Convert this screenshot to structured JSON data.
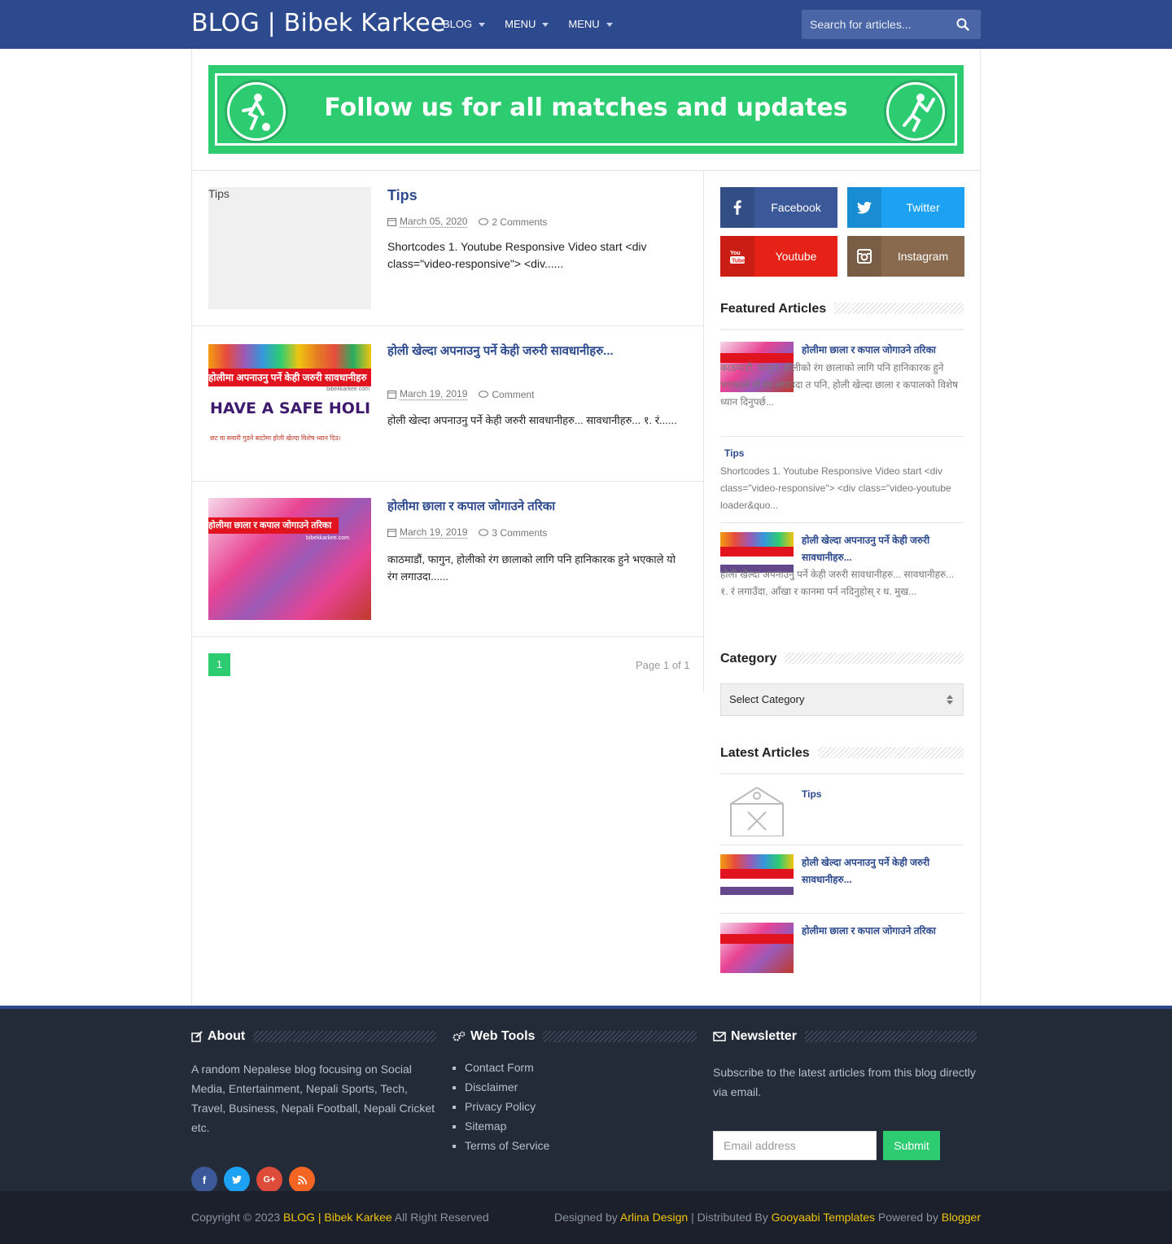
{
  "header": {
    "site_title": "BLOG | Bibek Karkee",
    "nav": [
      "BLOG",
      "MENU",
      "MENU"
    ],
    "search_placeholder": "Search for articles..."
  },
  "banner": {
    "text": "Follow us for  all matches and updates"
  },
  "posts": [
    {
      "thumb_alt": "Tips",
      "title": "Tips",
      "date": "March 05, 2020",
      "comments": "2 Comments",
      "excerpt": "Shortcodes 1. Youtube Responsive Video start <div class=\"video-responsive\"> <div......"
    },
    {
      "thumb_text_top": "होलीमा अपनाउनु पर्ने केही जरुरी सावधानीहरु",
      "thumb_text_mid": "HAVE A SAFE HOLI",
      "thumb_text_bot": "छट वा सवारी गुडने बाटोमा होली खेल्दा विशेष ध्यान दिउ।",
      "thumb_site": "bibekkarkee.com",
      "title": "होली खेल्दा अपनाउनु पर्ने केही जरुरी सावधानीहरु...",
      "date": "March 19, 2019",
      "comments": "Comment",
      "excerpt": "होली खेल्दा अपनाउनु पर्ने केही जरुरी सावधानीहरु... सावधानीहरु... १. रं......"
    },
    {
      "thumb_text_top": "होलीमा छाला र कपाल जोगाउने तरिका",
      "thumb_site": "bibekkarkee.com",
      "title": "होलीमा छाला र कपाल जोगाउने तरिका",
      "date": "March 19, 2019",
      "comments": "3 Comments",
      "excerpt": "काठमाडौं, फागुन, होलीको रंग छालाको लागि पनि हानिकारक हुने भएकाले यो रंग लगाउदा......"
    }
  ],
  "pagination": {
    "current": "1",
    "page_of": "Page 1 of 1"
  },
  "sidebar": {
    "social": [
      {
        "label": "Facebook",
        "color": "#3b5998"
      },
      {
        "label": "Twitter",
        "color": "#1da1f2"
      },
      {
        "label": "Youtube",
        "color": "#e62117"
      },
      {
        "label": "Instagram",
        "color": "#8a6a4f"
      }
    ],
    "featured_title": "Featured Articles",
    "featured": [
      {
        "title": "होलीमा छाला र कपाल जोगाउने तरिका",
        "excerpt": "काठमाडौं, फागुन, होलीको रंग छालाको लागि पनि हानिकारक हुने भएकाले यो रंग लगाउदा त पनि, होली खेल्दा छाला र कपालको विशेष ध्यान दिनुपर्छ..."
      },
      {
        "title": "Tips",
        "excerpt": "Shortcodes 1. Youtube Responsive Video start <div class=\"video-responsive\"> <div class=\"video-youtube loader&quo..."
      },
      {
        "title": "होली खेल्दा अपनाउनु पर्ने केही जरुरी सावधानीहरु...",
        "excerpt": "होली खेल्दा अपनाउनु पर्ने केही जरुरी सावधानीहरु... सावधानीहरु... १. रं लगाउँदा, आँखा र कानमा पर्न नदिनुहोस् र ध. मुख..."
      }
    ],
    "category_title": "Category",
    "category_select": "Select Category",
    "latest_title": "Latest Articles",
    "latest": [
      {
        "title": "Tips"
      },
      {
        "title": "होली खेल्दा अपनाउनु पर्ने केही जरुरी सावधानीहरु..."
      },
      {
        "title": "होलीमा छाला र कपाल जोगाउने तरिका"
      }
    ]
  },
  "footer": {
    "about_title": "About",
    "about_text": "A random Nepalese blog focusing on Social Media, Entertainment, Nepali Sports, Tech, Travel, Business, Nepali Football, Nepali Cricket etc.",
    "social_icons": [
      "facebook-icon",
      "twitter-icon",
      "google-plus-icon",
      "rss-icon"
    ],
    "tools_title": "Web Tools",
    "tools": [
      "Contact Form",
      "Disclaimer",
      "Privacy Policy",
      "Sitemap",
      "Terms of Service"
    ],
    "newsletter_title": "Newsletter",
    "newsletter_text": "Subscribe to the latest articles from this blog directly via email.",
    "email_placeholder": "Email address",
    "submit_label": "Submit"
  },
  "bottom": {
    "copy_prefix": "Copyright © 2023",
    "copy_site": "BLOG | Bibek Karkee",
    "copy_suffix": "All Right Reserved",
    "designed_by": "Designed by",
    "designer": "Arlina Design",
    "distributed_by": "| Distributed By",
    "distributor": "Gooyaabi Templates",
    "powered_by": "Powered by",
    "platform": "Blogger"
  },
  "colors": {
    "primary": "#2d4a8e",
    "accent": "#2ecc71",
    "footer": "#232a38",
    "link_yellow": "#f1c40f"
  }
}
